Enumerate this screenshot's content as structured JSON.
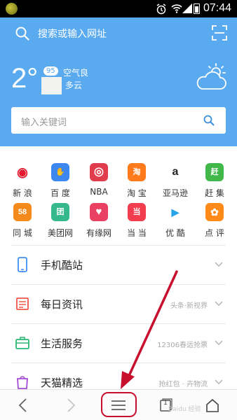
{
  "status_bar": {
    "time": "07:44"
  },
  "header": {
    "search_placeholder": "搜索或输入网址",
    "weather": {
      "temperature": "2°",
      "aqi": "95",
      "air_quality": "空气良",
      "condition": "多云"
    },
    "keyword_placeholder": "输入关键词"
  },
  "sites": [
    {
      "label": "新 浪",
      "icon": "weibo-icon",
      "glyph": "◉",
      "color": "#ffffff",
      "fg": "#e6162d"
    },
    {
      "label": "百 度",
      "icon": "baidu-paw-icon",
      "glyph": "✋",
      "color": "#3c88f0",
      "fg": "#ffffff"
    },
    {
      "label": "NBA",
      "icon": "nba-ball-icon",
      "glyph": "◎",
      "color": "#e03c4b",
      "fg": "#ffffff"
    },
    {
      "label": "淘 宝",
      "icon": "taobao-icon",
      "glyph": "淘",
      "color": "#ff7a1a",
      "fg": "#ffffff"
    },
    {
      "label": "亚马逊",
      "icon": "amazon-icon",
      "glyph": "a",
      "color": "#ffffff",
      "fg": "#222222"
    },
    {
      "label": "赶 集",
      "icon": "ganji-icon",
      "glyph": "赶",
      "color": "#43b84a",
      "fg": "#ffffff"
    },
    {
      "label": "同 城",
      "icon": "58-tongcheng-icon",
      "glyph": "58",
      "color": "#f48a1c",
      "fg": "#ffffff"
    },
    {
      "label": "美团网",
      "icon": "meituan-icon",
      "glyph": "团",
      "color": "#35b98c",
      "fg": "#ffffff"
    },
    {
      "label": "有缘网",
      "icon": "youyuan-heart-icon",
      "glyph": "♥",
      "color": "#ea4162",
      "fg": "#ffffff"
    },
    {
      "label": "当 当",
      "icon": "dangdang-icon",
      "glyph": "当",
      "color": "#f23d4f",
      "fg": "#ffffff"
    },
    {
      "label": "优 酷",
      "icon": "youku-play-icon",
      "glyph": "▶",
      "color": "#ffffff",
      "fg": "#27a4e8"
    },
    {
      "label": "点 评",
      "icon": "dianping-icon",
      "glyph": "✿",
      "color": "#ff8a1a",
      "fg": "#ffffff"
    }
  ],
  "sections": [
    {
      "title": "手机酷站",
      "tail": "",
      "icon": "phone-icon",
      "color": "#3f8ff0"
    },
    {
      "title": "每日资讯",
      "tail": "头条·新视界",
      "icon": "news-icon",
      "color": "#f0584c"
    },
    {
      "title": "生活服务",
      "tail": "12306春运抢票",
      "icon": "briefcase-icon",
      "color": "#2bb673"
    },
    {
      "title": "天猫精选",
      "tail": "抢红包 · 卉物流",
      "icon": "tmall-bag-icon",
      "color": "#a64bd6"
    }
  ],
  "bottom_nav": {
    "tab_count": "1"
  },
  "watermark": "Baidu 经验"
}
